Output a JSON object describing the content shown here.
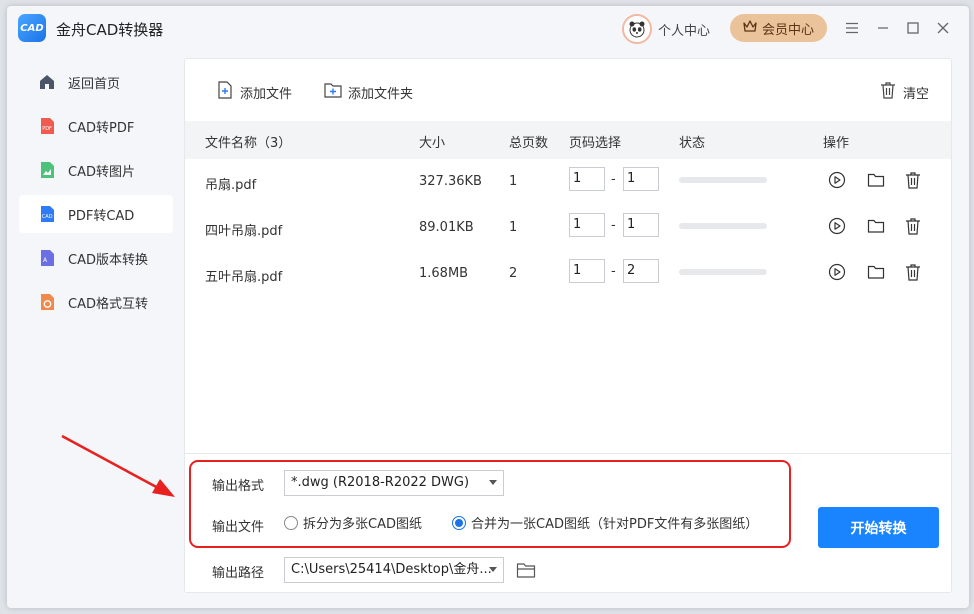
{
  "app": {
    "logo_text": "CAD",
    "title": "金舟CAD转换器"
  },
  "header": {
    "user_center": "个人中心",
    "vip": "会员中心"
  },
  "sidebar": {
    "items": [
      {
        "label": "返回首页",
        "icon": "home-icon",
        "color": "#4a5568"
      },
      {
        "label": "CAD转PDF",
        "icon": "pdf-icon",
        "color": "#f05a4f"
      },
      {
        "label": "CAD转图片",
        "icon": "image-icon",
        "color": "#4cc27b"
      },
      {
        "label": "PDF转CAD",
        "icon": "cad-icon",
        "color": "#2f7bf5",
        "active": true
      },
      {
        "label": "CAD版本转换",
        "icon": "version-icon",
        "color": "#6b6fe6"
      },
      {
        "label": "CAD格式互转",
        "icon": "format-icon",
        "color": "#f08a4b"
      }
    ]
  },
  "toolbar": {
    "add_file": "添加文件",
    "add_folder": "添加文件夹",
    "clear": "清空"
  },
  "table": {
    "headers": {
      "name": "文件名称（3）",
      "size": "大小",
      "pages": "总页数",
      "range": "页码选择",
      "status": "状态",
      "ops": "操作"
    },
    "rows": [
      {
        "name": "吊扇.pdf",
        "size": "327.36KB",
        "pages": "1",
        "from": "1",
        "to": "1",
        "progress": 0
      },
      {
        "name": "四叶吊扇.pdf",
        "size": "89.01KB",
        "pages": "1",
        "from": "1",
        "to": "1",
        "progress": 0
      },
      {
        "name": "五叶吊扇.pdf",
        "size": "1.68MB",
        "pages": "2",
        "from": "1",
        "to": "2",
        "progress": 0
      }
    ],
    "dash": "-"
  },
  "output": {
    "format_label": "输出格式",
    "format_value": "*.dwg (R2018-R2022 DWG)",
    "file_label": "输出文件",
    "option_split": "拆分为多张CAD图纸",
    "option_merge": "合并为一张CAD图纸（针对PDF文件有多张图纸）",
    "selected": "merge",
    "path_label": "输出路径",
    "path_value": "C:\\Users\\25414\\Desktop\\金舟..."
  },
  "start_button": "开始转换",
  "colors": {
    "accent": "#1a84ff",
    "highlight": "#e8201f",
    "vip": "#ebc39b"
  }
}
